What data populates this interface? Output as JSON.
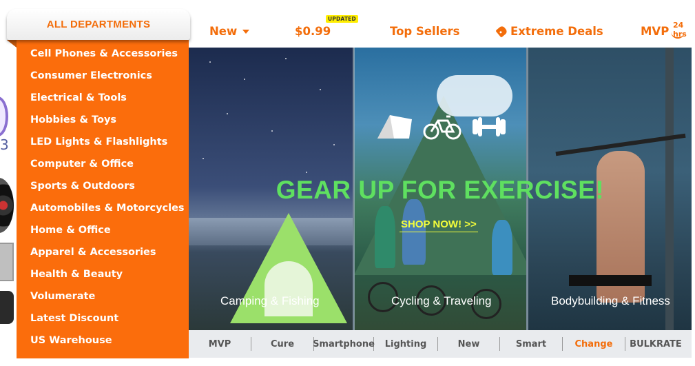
{
  "departments": {
    "title": "ALL DEPARTMENTS",
    "items": [
      "Cell Phones & Accessories",
      "Consumer Electronics",
      "Electrical & Tools",
      "Hobbies & Toys",
      "LED Lights & Flashlights",
      "Computer & Office",
      "Sports & Outdoors",
      "Automobiles & Motorcycles",
      "Home & Office",
      "Apparel & Accessories",
      "Health & Beauty",
      "Volumerate",
      "Latest Discount",
      "US Warehouse"
    ]
  },
  "nav": {
    "new": "New",
    "price": "$0.99",
    "updated_badge": "UPDATED",
    "top_sellers": "Top Sellers",
    "extreme_deals": "Extreme Deals",
    "mvp": "MVP",
    "hrs": "24 hrs"
  },
  "banner": {
    "headline": "GEAR UP FOR EXERCISE!",
    "cta": "SHOP NOW! >>",
    "captions": [
      "Camping & Fishing",
      "Cycling & Traveling",
      "Bodybuilding & Fitness"
    ],
    "icons": [
      "tent-icon",
      "bicycle-icon",
      "dumbbell-icon"
    ]
  },
  "strip": {
    "items": [
      "MVP",
      "Cure",
      "Smartphone",
      "Lighting",
      "New",
      "Smart",
      "Change",
      "BULKRATE"
    ],
    "highlighted_index": 6
  },
  "colors": {
    "accent": "#fb6d0c",
    "headline": "#5fe060",
    "cta": "#f5ff3a"
  }
}
